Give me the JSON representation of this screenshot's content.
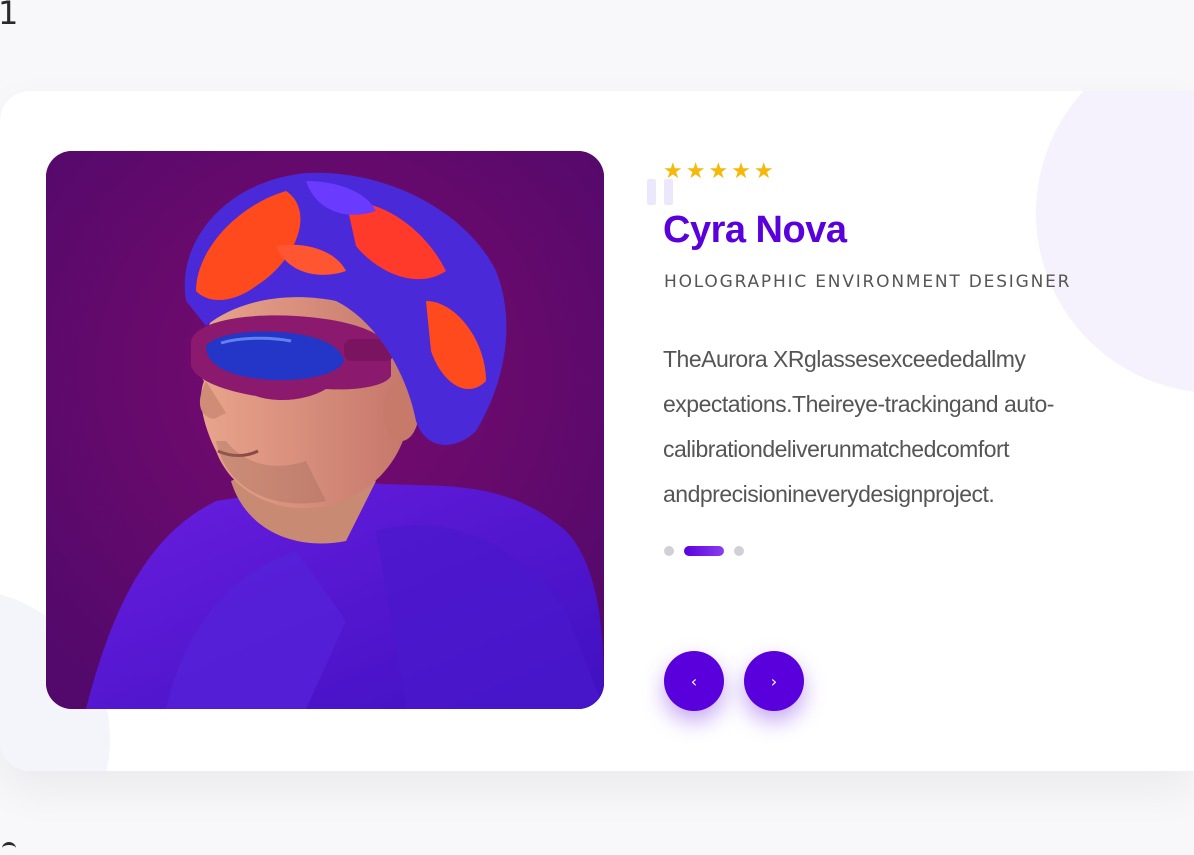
{
  "page_number": "1",
  "testimonial": {
    "rating": 5,
    "stars_text": "★★★★★",
    "name": "Cyra Nova",
    "role": "HOLOGRAPHIC ENVIRONMENT DESIGNER",
    "quote": "TheAurora XRglassesexceededallmy expectations.Theireye-trackingand auto-calibrationdeliverunmatchedcomfort andprecisionineverydesignproject.",
    "photo": "portrait-man-fur-hat-goggles"
  },
  "pagination": {
    "total": 3,
    "active_index": 1
  },
  "navigation": {
    "prev_label": "‹",
    "next_label": "›",
    "prev_icon": "chevron-left-icon",
    "next_icon": "chevron-right-icon"
  },
  "colors": {
    "accent": "#5a00dc",
    "stars": "#f5b90c",
    "text": "#555555"
  }
}
